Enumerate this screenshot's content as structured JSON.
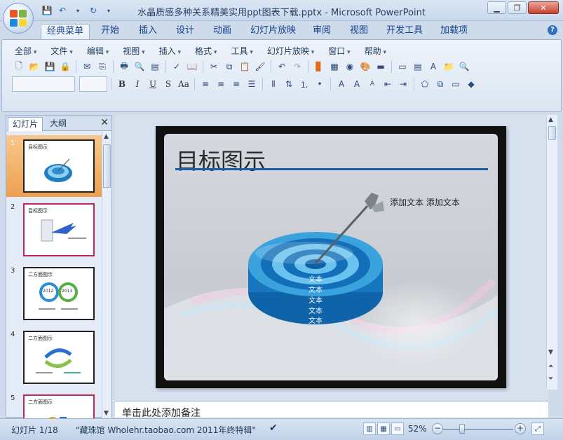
{
  "window": {
    "title": "水晶质感多种关系精美实用ppt图表下载.pptx - Microsoft PowerPoint",
    "minimize_icon": "minimize-icon",
    "maximize_icon": "restore-icon",
    "close_icon": "close-icon"
  },
  "quick_access": [
    "save-icon",
    "undo-icon",
    "redo-icon",
    "customize-icon"
  ],
  "ribbon_tabs": [
    "经典菜单",
    "开始",
    "插入",
    "设计",
    "动画",
    "幻灯片放映",
    "审阅",
    "视图",
    "开发工具",
    "加载项"
  ],
  "active_tab": "经典菜单",
  "classic_menu": [
    "全部",
    "文件",
    "编辑",
    "视图",
    "插入",
    "格式",
    "工具",
    "幻灯片放映",
    "窗口",
    "帮助"
  ],
  "format_buttons": [
    "B",
    "I",
    "U",
    "S",
    "Aa"
  ],
  "panel": {
    "tabs": [
      "幻灯片",
      "大纲"
    ],
    "active": "幻灯片",
    "thumbnails": [
      {
        "num": "1",
        "title": "目标图示",
        "selected": true
      },
      {
        "num": "2",
        "title": "目标图示",
        "selected": false
      },
      {
        "num": "3",
        "title": "二方面图示",
        "selected": false
      },
      {
        "num": "4",
        "title": "二方面图示",
        "selected": false
      },
      {
        "num": "5",
        "title": "二方面图示",
        "selected": false
      }
    ],
    "thumb3_years": [
      "2012",
      "2013"
    ]
  },
  "slide": {
    "title": "目标图示",
    "target_text": "添加文本  添加文本",
    "ring_labels": [
      "文本",
      "文本",
      "文本",
      "文本",
      "文本"
    ]
  },
  "notes": {
    "placeholder": "单击此处添加备注"
  },
  "status": {
    "slide_info": "幻灯片 1/18",
    "theme": "\"藏珠馆 Wholehr.taobao.com 2011年终特辑\"",
    "zoom": "52%"
  },
  "colors": {
    "accent": "#1d5fa3",
    "selected_thumb": "#eea04e",
    "target_blue": "#3aa2dd"
  }
}
